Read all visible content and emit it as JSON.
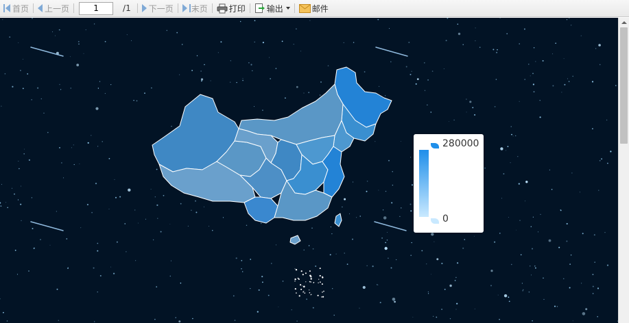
{
  "toolbar": {
    "first": "首页",
    "prev": "上一页",
    "page_value": "1",
    "page_total": "/1",
    "next": "下一页",
    "last": "末页",
    "print": "打印",
    "export": "输出",
    "mail": "邮件"
  },
  "icons": [
    "first-page-icon",
    "prev-page-icon",
    "next-page-icon",
    "last-page-icon",
    "printer-icon",
    "export-icon",
    "mail-icon",
    "chevron-down-icon"
  ],
  "map": {
    "legend": {
      "max_label": "280000",
      "min_label": "0"
    },
    "colors": {
      "background": "#021325",
      "high": "#1f8fea",
      "low": "#c9e9ff",
      "region": "#4a8fc4",
      "border": "#ffffff"
    }
  }
}
